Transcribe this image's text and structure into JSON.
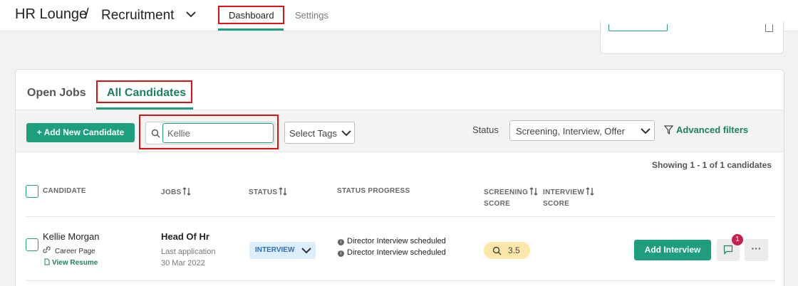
{
  "header": {
    "brand": "HR Lounge",
    "separator": "/",
    "project": "Recruitment",
    "tabs": [
      {
        "label": "Dashboard",
        "active": true
      },
      {
        "label": "Settings",
        "active": false
      }
    ]
  },
  "panel": {
    "tabs": [
      {
        "label": "Open Jobs",
        "active": false
      },
      {
        "label": "All Candidates",
        "active": true
      }
    ],
    "toolbar": {
      "add_label": "+ Add New Candidate",
      "search_value": "Kellie",
      "tags_label": "Select Tags",
      "status_label": "Status",
      "status_value": "Screening, Interview, Offer",
      "advanced_label": "Advanced filters"
    },
    "showing": "Showing 1 - 1 of 1 candidates",
    "columns": {
      "candidate": "CANDIDATE",
      "jobs": "JOBS",
      "status": "STATUS",
      "progress": "STATUS PROGRESS",
      "screening_1": "SCREENING",
      "screening_2": "SCORE",
      "interview_1": "INTERVIEW",
      "interview_2": "SCORE"
    },
    "rows": [
      {
        "name": "Kellie Morgan",
        "source": "Career Page",
        "resume": "View Resume",
        "job": "Head Of Hr",
        "job_sub1": "Last application",
        "job_sub2": "30 Mar 2022",
        "status": "INTERVIEW",
        "progress": [
          "Director Interview scheduled",
          "Director Interview scheduled"
        ],
        "screening_score": "3.5",
        "action": "Add Interview",
        "comments_badge": "1",
        "more": "···"
      }
    ]
  },
  "colors": {
    "accent": "#1f9e7d",
    "highlight": "#e01010",
    "badge": "#c8204e"
  }
}
